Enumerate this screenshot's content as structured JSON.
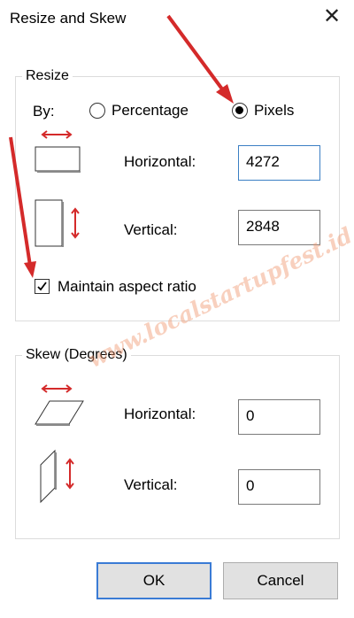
{
  "window": {
    "title": "Resize and Skew"
  },
  "resize": {
    "group_label": "Resize",
    "by_label": "By:",
    "option_percentage": "Percentage",
    "option_pixels": "Pixels",
    "selected": "Pixels",
    "horizontal_label": "Horizontal:",
    "horizontal_value": "4272",
    "vertical_label": "Vertical:",
    "vertical_value": "2848",
    "maintain_aspect_label": "Maintain aspect ratio",
    "maintain_aspect_checked": true
  },
  "skew": {
    "group_label": "Skew (Degrees)",
    "horizontal_label": "Horizontal:",
    "horizontal_value": "0",
    "vertical_label": "Vertical:",
    "vertical_value": "0"
  },
  "buttons": {
    "ok_label": "OK",
    "cancel_label": "Cancel"
  },
  "watermark": "www.localstartupfest.id",
  "colors": {
    "arrow_red": "#d42a2a",
    "focus_border": "#3b7fc4"
  }
}
